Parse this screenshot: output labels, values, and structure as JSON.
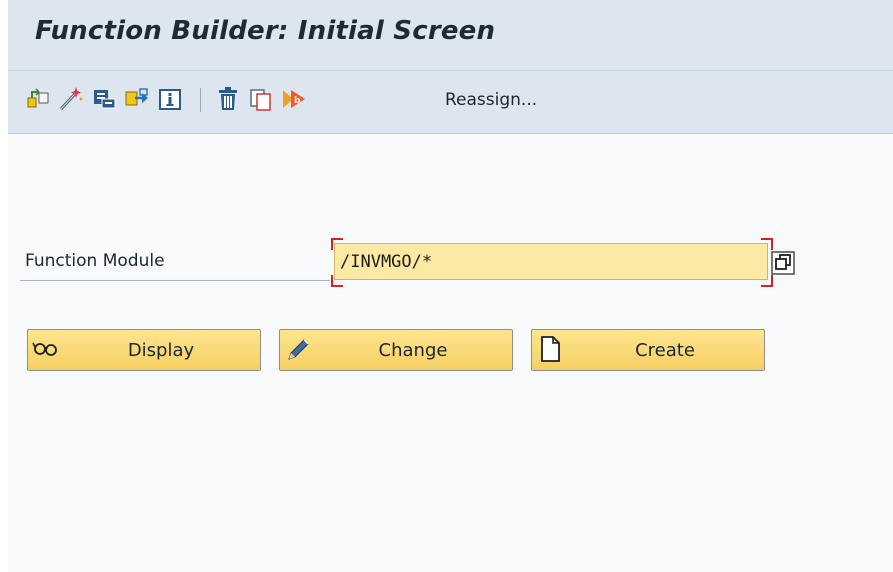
{
  "window": {
    "title": "Function Builder: Initial Screen"
  },
  "toolbar": {
    "icons": [
      "other-object-icon",
      "magic-wand-icon",
      "where-used-icon",
      "transport-icon",
      "info-icon",
      "delete-icon",
      "copy-icon",
      "rename-icon"
    ],
    "reassign_label": "Reassign..."
  },
  "form": {
    "function_module": {
      "label": "Function Module",
      "value": "/INVMGO/*",
      "required": true
    }
  },
  "actions": {
    "display_label": "Display",
    "change_label": "Change",
    "create_label": "Create"
  },
  "colors": {
    "title_bar": "#dde6ef",
    "button_face": "#f6cf62",
    "input_background": "#fbe9a4",
    "required_marker": "#d32222"
  }
}
